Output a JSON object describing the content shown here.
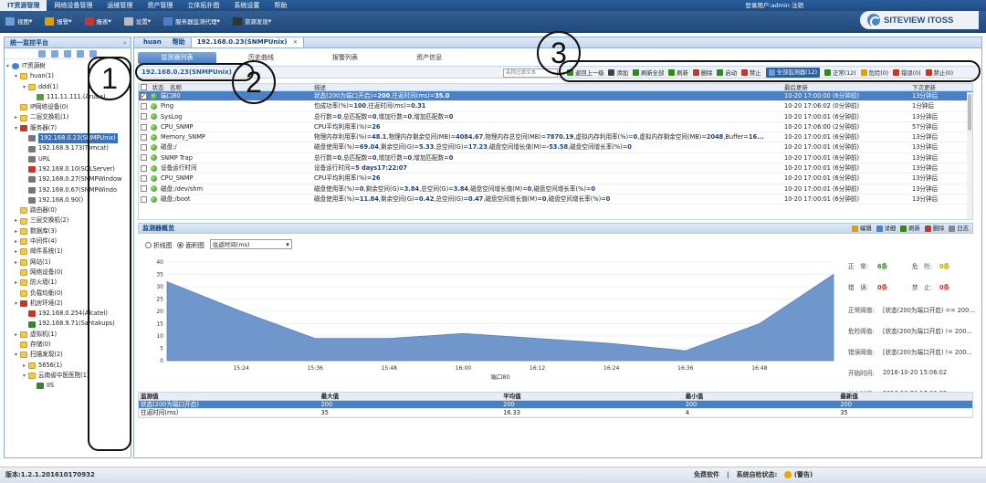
{
  "topnav": {
    "items": [
      "IT资源管理",
      "网络设备管理",
      "运维管理",
      "资产管理",
      "立体拓扑图",
      "系统设置",
      "帮助"
    ],
    "user": "登录用户:admin 注销"
  },
  "toolbar": {
    "items": [
      {
        "label": "视图",
        "icon": "view-icon"
      },
      {
        "label": "报警",
        "icon": "alarm-icon"
      },
      {
        "label": "报表",
        "icon": "report-icon"
      },
      {
        "label": "设置",
        "icon": "settings-icon"
      },
      {
        "label": "服务器监测代理",
        "icon": "agent-icon"
      },
      {
        "label": "资源发现",
        "icon": "discover-icon"
      }
    ]
  },
  "logo": {
    "text": "SITEVIEW ITOSS"
  },
  "sidebar": {
    "title": "统一监控平台",
    "tree": [
      {
        "label": "IT资源树",
        "indent": 0,
        "exp": "-",
        "icon": "ic-globe"
      },
      {
        "label": "huan(1)",
        "indent": 1,
        "exp": "-",
        "icon": "ic-folder"
      },
      {
        "label": "ddd(1)",
        "indent": 2,
        "exp": "-",
        "icon": "ic-folder"
      },
      {
        "label": "111.11.111.(Aruba)",
        "indent": 3,
        "exp": "",
        "icon": "ic-net"
      },
      {
        "label": "IP网络设备(0)",
        "indent": 1,
        "exp": "",
        "icon": "ic-folder"
      },
      {
        "label": "二层交换机(1)",
        "indent": 1,
        "exp": "+",
        "icon": "ic-folder"
      },
      {
        "label": "服务器(7)",
        "indent": 1,
        "exp": "-",
        "icon": "ic-srv-red"
      },
      {
        "label": "192.168.0.23(SNMPUnix)",
        "indent": 2,
        "exp": "",
        "icon": "ic-srv",
        "sel": true
      },
      {
        "label": "192.168.9.173(Tomcat)",
        "indent": 2,
        "exp": "",
        "icon": "ic-srv"
      },
      {
        "label": "URL",
        "indent": 2,
        "exp": "",
        "icon": "ic-srv"
      },
      {
        "label": "192.168.0.10(SQLServer)",
        "indent": 2,
        "exp": "",
        "icon": "ic-srv-red"
      },
      {
        "label": "192.168.0.27(SNMPWindow",
        "indent": 2,
        "exp": "",
        "icon": "ic-srv"
      },
      {
        "label": "192.168.0.67(SNMPWindo",
        "indent": 2,
        "exp": "",
        "icon": "ic-srv"
      },
      {
        "label": "192.168.0.90()",
        "indent": 2,
        "exp": "",
        "icon": "ic-srv"
      },
      {
        "label": "路由器(0)",
        "indent": 1,
        "exp": "",
        "icon": "ic-folder"
      },
      {
        "label": "三层交换机(2)",
        "indent": 1,
        "exp": "+",
        "icon": "ic-folder"
      },
      {
        "label": "数据库(3)",
        "indent": 1,
        "exp": "+",
        "icon": "ic-folder"
      },
      {
        "label": "中间件(4)",
        "indent": 1,
        "exp": "+",
        "icon": "ic-folder"
      },
      {
        "label": "邮件系统(1)",
        "indent": 1,
        "exp": "+",
        "icon": "ic-folder"
      },
      {
        "label": "网站(1)",
        "indent": 1,
        "exp": "+",
        "icon": "ic-folder"
      },
      {
        "label": "网络设备(0)",
        "indent": 1,
        "exp": "",
        "icon": "ic-folder"
      },
      {
        "label": "防火墙(1)",
        "indent": 1,
        "exp": "+",
        "icon": "ic-folder"
      },
      {
        "label": "负载均衡(0)",
        "indent": 1,
        "exp": "",
        "icon": "ic-folder"
      },
      {
        "label": "机房环境(2)",
        "indent": 1,
        "exp": "-",
        "icon": "ic-srv-red"
      },
      {
        "label": "192.168.0.254(Alcatel)",
        "indent": 2,
        "exp": "",
        "icon": "ic-srv-red"
      },
      {
        "label": "192.168.9.71(Santakups)",
        "indent": 2,
        "exp": "",
        "icon": "ic-db"
      },
      {
        "label": "虚拟机(1)",
        "indent": 1,
        "exp": "+",
        "icon": "ic-folder"
      },
      {
        "label": "存储(0)",
        "indent": 1,
        "exp": "",
        "icon": "ic-folder"
      },
      {
        "label": "扫描发现(2)",
        "indent": 1,
        "exp": "-",
        "icon": "ic-folder"
      },
      {
        "label": "5656(1)",
        "indent": 2,
        "exp": "+",
        "icon": "ic-folder"
      },
      {
        "label": "云南省中医医院(1)",
        "indent": 2,
        "exp": "-",
        "icon": "ic-folder"
      },
      {
        "label": "IIS",
        "indent": 3,
        "exp": "",
        "icon": "ic-db"
      }
    ]
  },
  "main": {
    "tabs": [
      {
        "label": "huan"
      },
      {
        "label": "帮助"
      },
      {
        "label": "192.168.0.23(SNMPUnix)",
        "active": true,
        "close": "×"
      }
    ],
    "subtabs": [
      "监测器列表",
      "历史曲线",
      "报警列表",
      "资产信息"
    ],
    "path": "192.168.0.23(SNMPUnix)",
    "search_placeholder": "名称过滤文本",
    "actions": [
      {
        "label": "返回上一级",
        "color": "#2f8a1a"
      },
      {
        "label": "添加",
        "color": "#444"
      },
      {
        "label": "刷新全部",
        "color": "#2f8a1a"
      },
      {
        "label": "刷新",
        "color": "#2f8a1a"
      },
      {
        "label": "删除",
        "color": "#c0392b"
      },
      {
        "label": "启动",
        "color": "#2f8a1a"
      },
      {
        "label": "禁止",
        "color": "#c0392b"
      },
      {
        "label": "全部监测器(12)",
        "color": "#6a9fd8",
        "hl": true
      },
      {
        "label": "正常(12)",
        "color": "#2f8a1a"
      },
      {
        "label": "危险(0)",
        "color": "#e0a000"
      },
      {
        "label": "错误(0)",
        "color": "#c0392b"
      },
      {
        "label": "禁止(0)",
        "color": "#c0392b"
      }
    ],
    "grid": {
      "headers": [
        "状态",
        "名称",
        "描述",
        "最后更新",
        "下次更新"
      ],
      "rows": [
        {
          "name": "端口80",
          "desc": "状态(200为端口开启)=200,往返时间(ms)=35.0",
          "last": "10-20 17:00:00 (6分钟前)",
          "next": "13分钟后",
          "sel": true
        },
        {
          "name": "Ping",
          "desc": "包成功率(%)=100,往返时间(ms)=0.31",
          "last": "10-20 17:06:02 (0分钟前)",
          "next": "1分钟后"
        },
        {
          "name": "SysLog",
          "desc": "总行数=0,总匹配数=0,增加行数=0,增加匹配数=0",
          "last": "10-20 17:00:01 (6分钟前)",
          "next": "13分钟后"
        },
        {
          "name": "CPU_SNMP",
          "desc": "CPU平均利用率(%)=26",
          "last": "10-20 17:06:00 (2分钟前)",
          "next": "57分钟后"
        },
        {
          "name": "Memory_SNMP",
          "desc": "物理内存利用率(%)=48.1,物理内存剩余空间(MB)=4084.67,物理内存总空间(MB)=7870.19,虚拟内存利用率(%)=0,虚拟内存剩余空间(MB)=2048,Buffer=16...",
          "last": "10-20 17:00:01 (6分钟前)",
          "next": "13分钟后"
        },
        {
          "name": "磁盘:/",
          "desc": "磁盘使用率(%)=69.04,剩余空间(G)=5.33,总空间(G)=17.23,磁盘空间增长值(M)=-53.58,磁盘空间增长率(%)=0",
          "last": "10-20 17:00:01 (6分钟前)",
          "next": "13分钟后"
        },
        {
          "name": "SNMP Trap",
          "desc": "总行数=0,总匹配数=0,增加行数=0,增加匹配数=0",
          "last": "10-20 17:00:01 (6分钟前)",
          "next": "13分钟后"
        },
        {
          "name": "设备运行时间",
          "desc": "设备运行时间=5 days17:22:07",
          "last": "10-20 17:00:01 (6分钟前)",
          "next": "13分钟后"
        },
        {
          "name": "CPU_SNMP",
          "desc": "CPU平均利用率(%)=26",
          "last": "10-20 17:00:01 (6分钟前)",
          "next": "13分钟后"
        },
        {
          "name": "磁盘:/dev/shm",
          "desc": "磁盘使用率(%)=0,剩余空间(G)=3.84,总空间(G)=3.84,磁盘空间增长值(M)=0,磁盘空间增长率(%)=0",
          "last": "10-20 17:00:01 (6分钟前)",
          "next": "13分钟后"
        },
        {
          "name": "磁盘:/boot",
          "desc": "磁盘使用率(%)=11.84,剩余空间(G)=0.42,总空间(G)=0.47,磁盘空间增长值(M)=0,磁盘空间增长率(%)=0",
          "last": "10-20 17:00:01 (6分钟前)",
          "next": "13分钟后"
        }
      ]
    },
    "overview": {
      "title": "监测器概览",
      "actions": [
        {
          "label": "编辑",
          "color": "#e0a000"
        },
        {
          "label": "详细",
          "color": "#4a80c4"
        },
        {
          "label": "刷新",
          "color": "#2f8a1a"
        },
        {
          "label": "删除",
          "color": "#c0392b"
        },
        {
          "label": "日志",
          "color": "#888"
        }
      ],
      "chart_types": [
        "折线图",
        "面积图"
      ],
      "selected_metric": "往返时间(ms)",
      "stats": {
        "normal_k": "正　常:",
        "normal_v": "6条",
        "danger_k": "危　险:",
        "danger_v": "0条",
        "error_k": "错　误:",
        "error_v": "0条",
        "disabled_k": "禁　止:",
        "disabled_v": "0条"
      },
      "labels": [
        {
          "k": "正常阈值:",
          "v": "[状态(200为端口开启) == 200..."
        },
        {
          "k": "危险阈值:",
          "v": "[状态(200为端口开启) != 200..."
        },
        {
          "k": "错误阈值:",
          "v": "[状态(200为端口开启) != 200..."
        },
        {
          "k": "开始时间:",
          "v": "2016-10-20 15:06:02"
        },
        {
          "k": "结束时间:",
          "v": "2016-10-20 17:06:02"
        }
      ],
      "table": {
        "headers": [
          "监测值",
          "最大值",
          "平均值",
          "最小值",
          "最新值"
        ],
        "rows": [
          [
            "状态(200为端口开启)",
            "200",
            "200",
            "200",
            "200"
          ],
          [
            "往返时间(ms)",
            "35",
            "16.33",
            "4",
            "35"
          ]
        ]
      }
    }
  },
  "chart_data": {
    "type": "area",
    "xlabel": "端口80",
    "x": [
      "15:06",
      "15:24",
      "15:36",
      "15:48",
      "16:00",
      "16:12",
      "16:24",
      "16:36",
      "16:48",
      "17:06"
    ],
    "x_ticks": [
      "15:24",
      "15:36",
      "15:48",
      "16:00",
      "16:12",
      "16:24",
      "16:36",
      "16:48"
    ],
    "values": [
      32,
      20,
      9,
      9,
      11,
      9,
      7,
      4,
      15,
      35
    ],
    "ylim": [
      0,
      40
    ],
    "yticks": [
      0,
      5,
      10,
      15,
      20,
      25,
      30,
      35,
      40
    ],
    "color": "#6f97cc"
  },
  "statusbar": {
    "version": "版本:1.2.1.201610170932",
    "free": "免费软件",
    "sep": "|",
    "selfcheck": "系统自检状态:",
    "warn": "(警告)"
  },
  "callouts": [
    "1",
    "2",
    "3"
  ]
}
